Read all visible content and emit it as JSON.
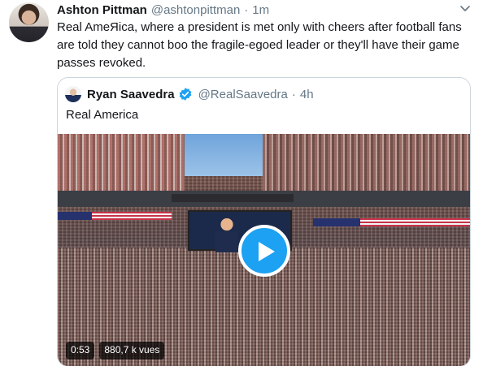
{
  "tweet": {
    "author_name": "Ashton Pittman",
    "author_handle": "@ashtonpittman",
    "separator": "·",
    "time": "1m",
    "text": "Real AmeЯica, where a president is met only with cheers after football fans are told they cannot boo the fragile-egoed leader or they'll have their game passes revoked."
  },
  "quoted_tweet": {
    "author_name": "Ryan Saavedra",
    "author_handle": "@RealSaavedra",
    "separator": "·",
    "time": "4h",
    "text": "Real America",
    "video": {
      "duration": "0:53",
      "views": "880,7 k vues"
    }
  },
  "colors": {
    "accent": "#1da1f2",
    "text_primary": "#14171a",
    "text_secondary": "#657786",
    "border": "#ccd6dd"
  },
  "icons": {
    "caret": "chevron-down-icon",
    "verified": "verified-badge-icon",
    "play": "play-icon"
  }
}
